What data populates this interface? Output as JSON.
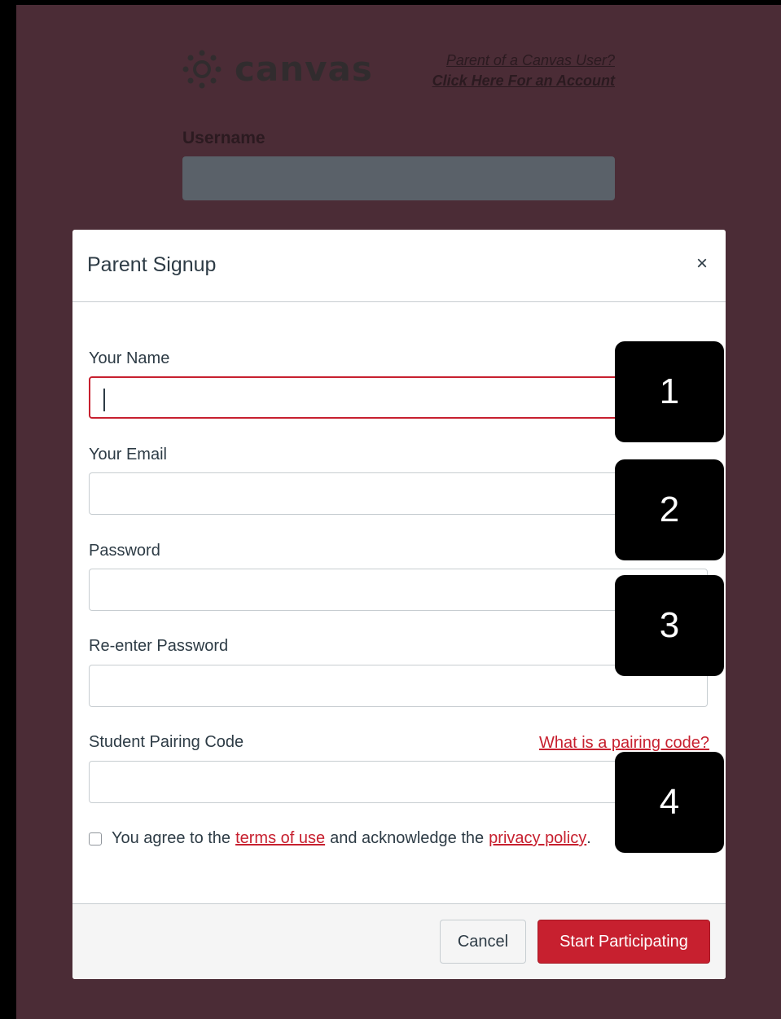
{
  "app": {
    "logo_text": "canvas",
    "parent_link_1": "Parent of a Canvas User?",
    "parent_link_2": "Click Here For an Account",
    "username_label": "Username"
  },
  "modal": {
    "title": "Parent Signup",
    "close_icon": "×",
    "fields": [
      {
        "label": "Your Name",
        "value": ""
      },
      {
        "label": "Your Email",
        "value": ""
      },
      {
        "label": "Password",
        "value": ""
      },
      {
        "label": "Re-enter Password",
        "value": ""
      },
      {
        "label": "Student Pairing Code",
        "value": ""
      }
    ],
    "pairing_help_link": "What is a pairing code?",
    "agree_prefix": "You agree to the",
    "terms_link": "terms of use",
    "agree_middle": "and acknowledge the",
    "privacy_link": "privacy policy",
    "agree_suffix": ".",
    "cancel_label": "Cancel",
    "submit_label": "Start Participating"
  },
  "callouts": [
    "1",
    "2",
    "3",
    "4"
  ],
  "colors": {
    "backdrop": "#4b2c36",
    "accent": "#c7202f",
    "error_border": "#c7202f"
  }
}
